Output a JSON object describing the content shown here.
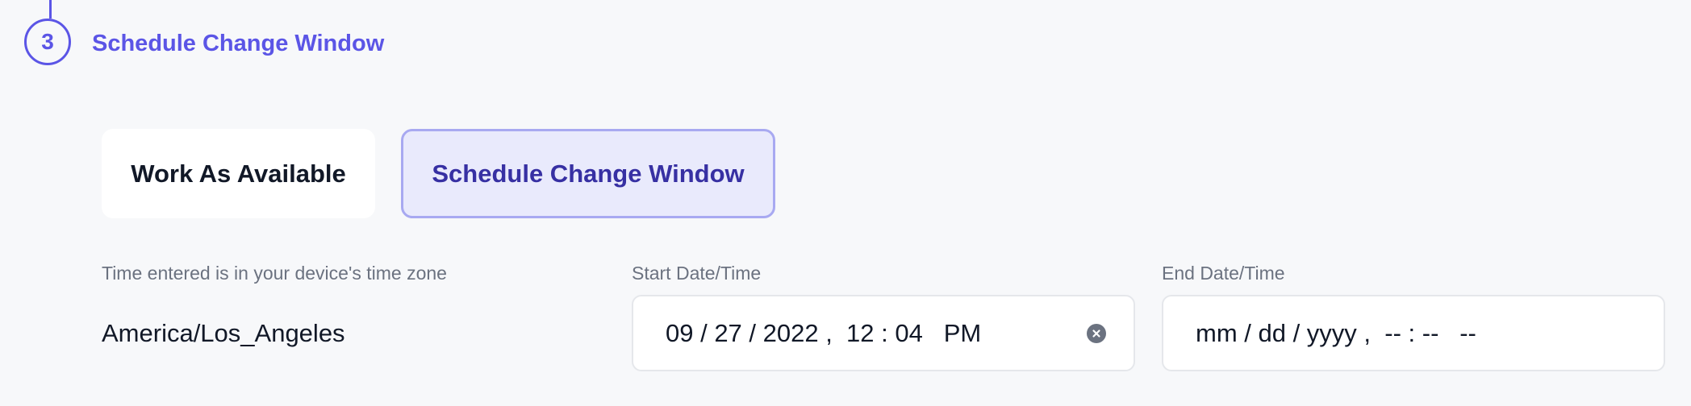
{
  "step": {
    "number": "3",
    "title": "Schedule Change Window"
  },
  "options": {
    "work_as_available": "Work As Available",
    "schedule_change_window": "Schedule Change Window",
    "selected": "schedule_change_window"
  },
  "timezone": {
    "label": "Time entered is in your device's time zone",
    "value": "America/Los_Angeles"
  },
  "start": {
    "label": "Start Date/Time",
    "value": "09 / 27 / 2022 ,  12 : 04   PM",
    "clear_icon": "clear-circle-x-icon"
  },
  "end": {
    "label": "End Date/Time",
    "value": "mm / dd / yyyy ,  -- : --   --"
  },
  "colors": {
    "accent": "#5b55e6",
    "selected_bg": "#e9eafc",
    "selected_border": "#a8a9f1",
    "selected_text": "#3730a3",
    "page_bg": "#f7f8fa"
  }
}
